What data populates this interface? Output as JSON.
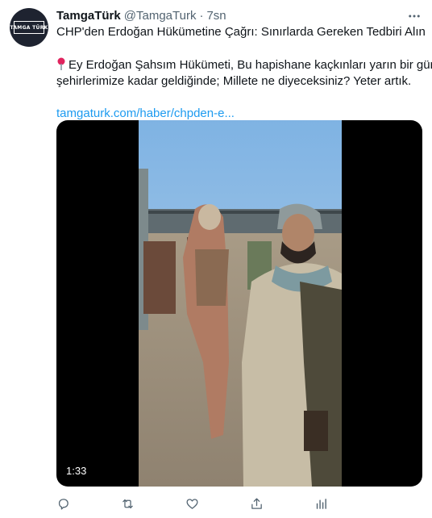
{
  "account": {
    "avatar_logo": "TAMGA TÜRK",
    "name": "TamgaTürk",
    "handle": "@TamgaTurk",
    "separator": "·",
    "time": "7sn"
  },
  "tweet": {
    "line1": "CHP'den Erdoğan Hükümetine Çağrı: Sınırlarda Gereken Tedbiri Alın",
    "line2": "Ey Erdoğan Şahsım Hükümeti, Bu hapishane kaçkınları yarın bir gün",
    "line3": "şehirlerimize kadar geldiğinde; Millete ne diyeceksiniz? Yeter artık.",
    "link": "tamgaturk.com/haber/chpden-e..."
  },
  "media": {
    "duration": "1:33"
  },
  "icons": {
    "more": "more-horizontal-icon",
    "pin": "round-pushpin-icon",
    "reply": "reply-icon",
    "retweet": "retweet-icon",
    "like": "heart-icon",
    "share": "share-icon",
    "analytics": "analytics-icon"
  },
  "colors": {
    "text": "#0f1419",
    "secondary": "#536471",
    "link": "#1d9bf0",
    "pin": "#e0245e"
  }
}
